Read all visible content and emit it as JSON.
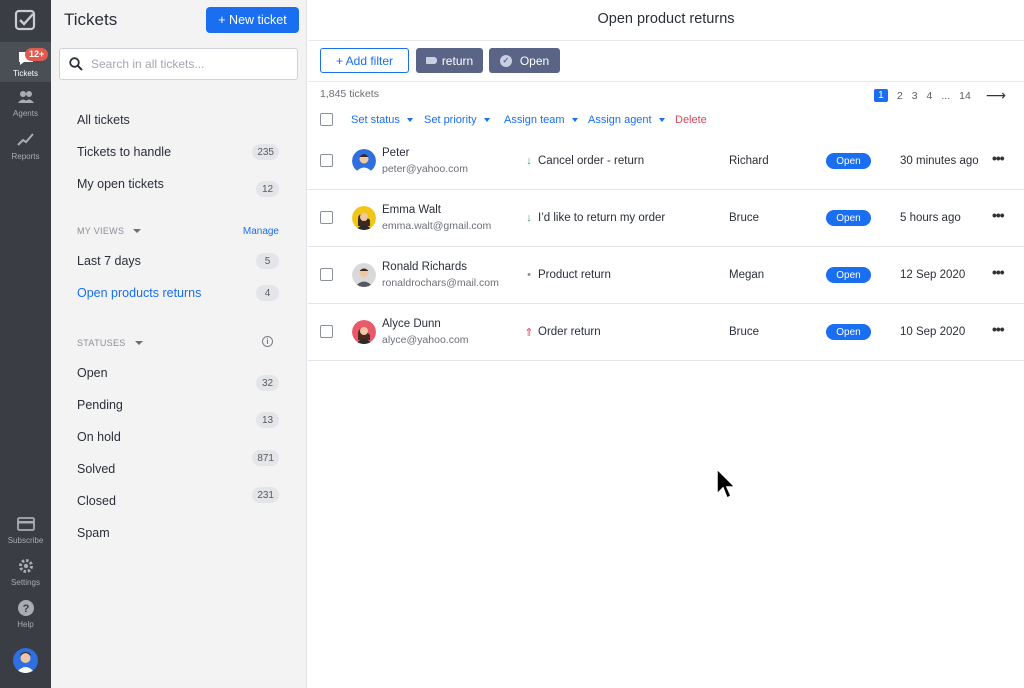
{
  "rail": {
    "items": [
      {
        "label": "Tickets",
        "icon": "tickets-icon",
        "badge": "12+",
        "active": true
      },
      {
        "label": "Agents",
        "icon": "agents-icon"
      },
      {
        "label": "Reports",
        "icon": "reports-icon"
      },
      {
        "label": "Subscribe",
        "icon": "card-icon"
      },
      {
        "label": "Settings",
        "icon": "gear-icon"
      },
      {
        "label": "Help",
        "icon": "help-icon"
      }
    ]
  },
  "panel": {
    "title": "Tickets",
    "new_ticket_label": "+ New ticket",
    "search_placeholder": "Search in all tickets...",
    "nav": [
      {
        "label": "All tickets"
      },
      {
        "label": "Tickets to handle",
        "count": "235"
      },
      {
        "label": "My open tickets",
        "count": "12"
      }
    ],
    "my_views_label": "MY VIEWS",
    "manage_label": "Manage",
    "views": [
      {
        "label": "Last 7 days",
        "count": "5"
      },
      {
        "label": "Open products returns",
        "count": "4",
        "active": true
      }
    ],
    "statuses_label": "STATUSES",
    "statuses": [
      {
        "label": "Open",
        "count": "32"
      },
      {
        "label": "Pending",
        "count": "13"
      },
      {
        "label": "On hold",
        "count": "871"
      },
      {
        "label": "Solved",
        "count": "231"
      },
      {
        "label": "Closed"
      },
      {
        "label": "Spam"
      }
    ]
  },
  "main": {
    "title": "Open product returns",
    "add_filter_label": "+ Add filter",
    "chips": [
      "return",
      "Open"
    ],
    "ticket_count": "1,845 tickets",
    "pager": {
      "pages": [
        "1",
        "2",
        "3",
        "4",
        "...",
        "14"
      ],
      "current": "1"
    },
    "actions": [
      "Set status",
      "Set priority",
      "Assign team",
      "Assign agent",
      "Delete"
    ],
    "rows": [
      {
        "name": "Peter",
        "email": "peter@yahoo.com",
        "priority": "low",
        "subject": "Cancel order - return",
        "agent": "Richard",
        "status": "Open",
        "time": "30 minutes ago"
      },
      {
        "name": "Emma Walt",
        "email": "emma.walt@gmail.com",
        "priority": "low",
        "subject": "I’d like to return my order",
        "agent": "Bruce",
        "status": "Open",
        "time": "5 hours ago"
      },
      {
        "name": "Ronald Richards",
        "email": "ronaldrochars@mail.com",
        "priority": "normal",
        "subject": "Product return",
        "agent": "Megan",
        "status": "Open",
        "time": "12 Sep 2020"
      },
      {
        "name": "Alyce Dunn",
        "email": "alyce@yahoo.com",
        "priority": "urgent",
        "subject": "Order return",
        "agent": "Bruce",
        "status": "Open",
        "time": "10 Sep 2020"
      }
    ]
  },
  "colors": {
    "accent": "#1a6ef0",
    "rail": "#3a3d43",
    "chip": "#5a6487",
    "delete": "#d24a5a",
    "priority_low": "#2e9e6a",
    "priority_urgent": "#d24a5a",
    "priority_normal": "#8a8e95"
  }
}
